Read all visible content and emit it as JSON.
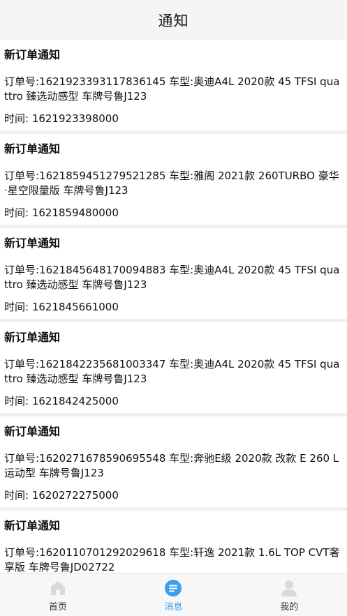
{
  "header": {
    "title": "通知"
  },
  "notifications": [
    {
      "title": "新订单通知",
      "body": "订单号:1621923393117836145 车型:奥迪A4L 2020款 45 TFSI quattro 臻选动感型 车牌号鲁J123",
      "time": "时间: 1621923398000"
    },
    {
      "title": "新订单通知",
      "body": "订单号:1621859451279521285 车型:雅阁 2021款 260TURBO 豪华·星空限量版 车牌号鲁J123",
      "time": "时间: 1621859480000"
    },
    {
      "title": "新订单通知",
      "body": "订单号:1621845648170094883 车型:奥迪A4L 2020款 45 TFSI quattro 臻选动感型 车牌号鲁J123",
      "time": "时间: 1621845661000"
    },
    {
      "title": "新订单通知",
      "body": "订单号:1621842235681003347 车型:奥迪A4L 2020款 45 TFSI quattro 臻选动感型 车牌号鲁J123",
      "time": "时间: 1621842425000"
    },
    {
      "title": "新订单通知",
      "body": "订单号:1620271678590695548 车型:奔驰E级 2020款 改款 E 260 L 运动型 车牌号鲁J123",
      "time": "时间: 1620272275000"
    },
    {
      "title": "新订单通知",
      "body": "订单号:1620110701292029618 车型:轩逸 2021款 1.6L TOP CVT奢享版 车牌号鲁JD02722",
      "time": ""
    }
  ],
  "tabbar": {
    "home": {
      "label": "首页",
      "icon": "home-icon"
    },
    "messages": {
      "label": "消息",
      "icon": "message-icon"
    },
    "mine": {
      "label": "我的",
      "icon": "user-icon"
    }
  },
  "colors": {
    "active": "#3aa0ee",
    "inactive_icon": "#d9d9d9"
  }
}
